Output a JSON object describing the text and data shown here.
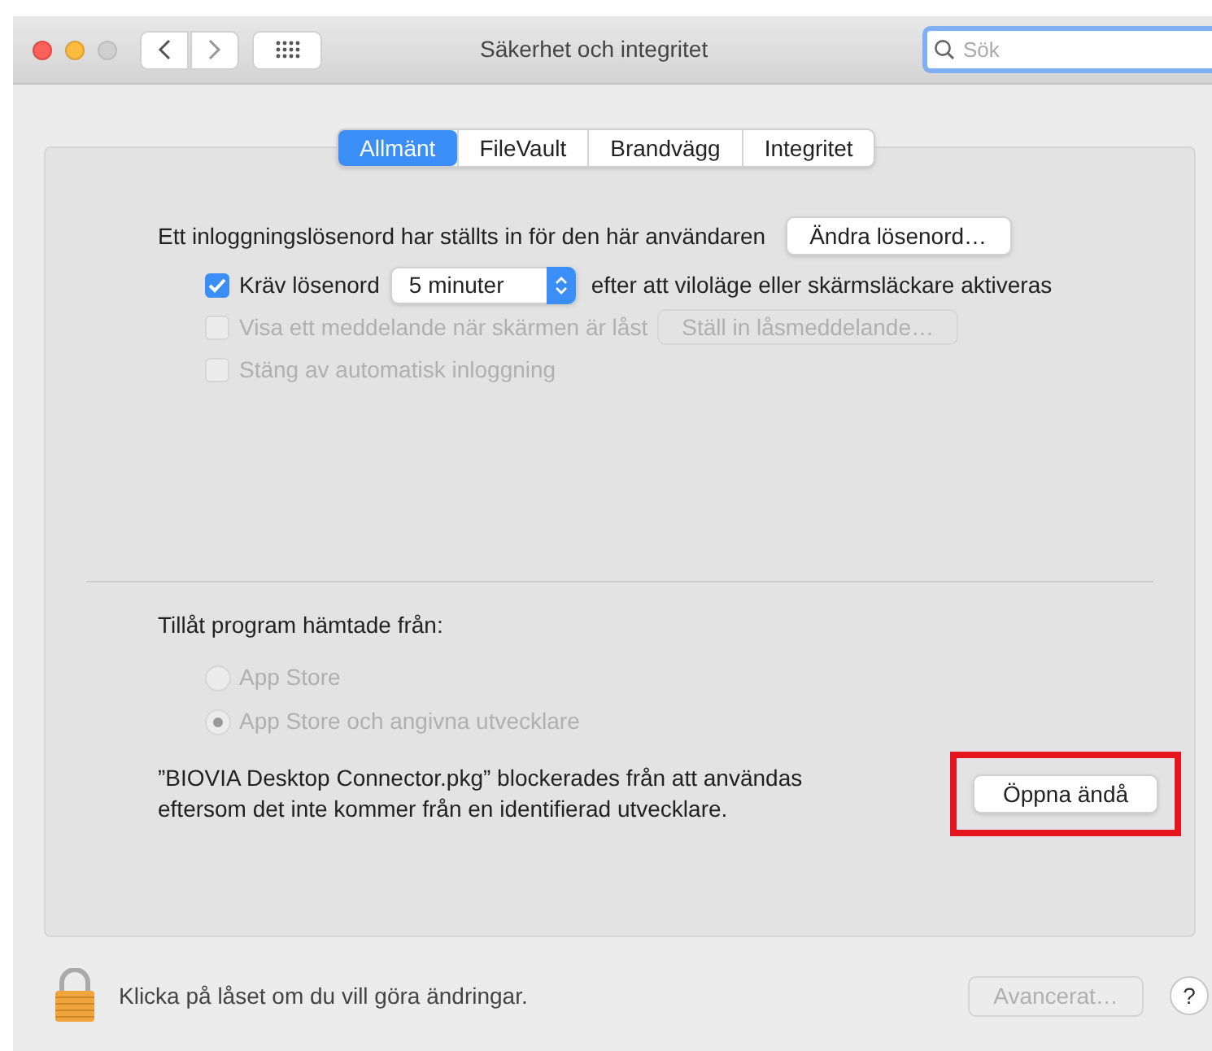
{
  "window": {
    "title": "Säkerhet och integritet",
    "controls": [
      {
        "kind": "close",
        "disabled": false
      },
      {
        "kind": "minimize",
        "disabled": false
      },
      {
        "kind": "zoom",
        "disabled": true
      }
    ],
    "search": {
      "placeholder": "Sök",
      "focused": true
    }
  },
  "tabs": [
    {
      "label": "Allmänt",
      "selected": true
    },
    {
      "label": "FileVault",
      "selected": false
    },
    {
      "label": "Brandvägg",
      "selected": false
    },
    {
      "label": "Integritet",
      "selected": false
    }
  ],
  "general": {
    "password_text": "Ett inloggningslösenord har ställts in för den här användaren",
    "change_password_button": "Ändra lösenord…",
    "options": [
      {
        "kind": "delay",
        "label": "Kräv lösenord",
        "checked": true,
        "disabled": false,
        "dropdown": "5 minuter",
        "suffix": "efter att viloläge eller skärmsläckare aktiveras"
      },
      {
        "kind": "button",
        "label": "Visa ett meddelande när skärmen är låst",
        "checked": false,
        "disabled": true,
        "button": "Ställ in låsmeddelande…"
      },
      {
        "kind": "plain",
        "label": "Stäng av automatisk inloggning",
        "checked": false,
        "disabled": true
      }
    ]
  },
  "downloads": {
    "heading": "Tillåt program hämtade från:",
    "sources": [
      {
        "label": "App Store",
        "selected": false,
        "disabled": true
      },
      {
        "label": "App Store och angivna utvecklare",
        "selected": true,
        "disabled": true
      }
    ],
    "message": "”BIOVIA Desktop Connector.pkg” blockerades från att användas eftersom det inte kommer från en identifierad utvecklare.",
    "open_button": {
      "label": "Öppna ändå",
      "highlighted": true
    }
  },
  "footer": {
    "lock_text": "Klicka på låset om du vill göra ändringar.",
    "advanced_button": {
      "label": "Avancerat…",
      "disabled": true
    },
    "help_button": "?"
  }
}
